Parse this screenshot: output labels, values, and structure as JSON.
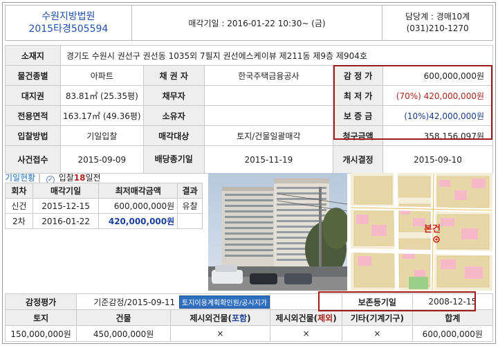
{
  "header": {
    "court_name": "수원지방법원",
    "case_no": "2015타경505594",
    "sale_date": "매각기일 : 2016-01-22   10:30~ (금)",
    "dept": "담당계 : 경매10계",
    "phone": "(031)210-1270"
  },
  "info": {
    "location_label": "소재지",
    "location": "경기도 수원시 권선구 권선동 1035외 7필지 권선에스케이뷰 제211동 제9층 제904호",
    "type_label": "물건종별",
    "type": "아파트",
    "creditor_label": "채 권 자",
    "creditor": "한국주택금융공사",
    "appraisal_label": "감 정 가",
    "appraisal": "600,000,000원",
    "land_label": "대지권",
    "land": "83.81㎡ (25.35평)",
    "debtor_label": "채무자",
    "debtor": "",
    "minimum_label": "최 저 가",
    "minimum": "(70%) 420,000,000원",
    "area_label": "전용면적",
    "area": "163.17㎡ (49.36평)",
    "owner_label": "소유자",
    "owner": "",
    "deposit_label": "보 증 금",
    "deposit": "(10%)42,000,000원",
    "method_label": "입찰방법",
    "method": "기일입찰",
    "target_label": "매각대상",
    "target": "토지/건물일괄매각",
    "claim_label": "청구금액",
    "claim": "358,156,097원",
    "received_label": "사건접수",
    "received": "2015-09-09",
    "dividend_label": "배당종기일",
    "dividend": "2015-11-19",
    "decision_label": "개시결정",
    "decision": "2015-09-10"
  },
  "history": {
    "title": "기일현황",
    "dday_prefix": "입찰",
    "dday_num": "18",
    "dday_suffix": "일전",
    "columns": [
      "회차",
      "매각기일",
      "최저매각금액",
      "결과"
    ],
    "rows": [
      {
        "round": "신건",
        "date": "2015-12-15",
        "amount": "600,000,000원",
        "result": "유찰"
      },
      {
        "round": "2차",
        "date": "2016-01-22",
        "amount": "420,000,000원",
        "result": ""
      }
    ]
  },
  "map": {
    "label": "본건"
  },
  "bottom": {
    "eval_label": "감정평가",
    "eval_value": "기준감정/2015-09-11",
    "eval_button": "토지이용계획확인원/공시지가",
    "preserve_label": "보존등기일",
    "preserve_value": "2008-12-15",
    "columns": {
      "land": "토지",
      "building": "건물",
      "excl_prefix": "제시외건물(",
      "excl_incl": "포함",
      "excl_excl": "제외",
      "close_paren": ")",
      "other": "기타(기계기구)",
      "total": "합계"
    },
    "values": {
      "land": "150,000,000원",
      "building": "450,000,000원",
      "excl_incl": "×",
      "excl_excl": "×",
      "other": "×",
      "total": "600,000,000원"
    }
  },
  "colors": {
    "red_frame": "#a01a1a",
    "label_bg": "#eeeeee",
    "link_blue": "#2f6fc0",
    "min_price_red": "#a8261c"
  }
}
